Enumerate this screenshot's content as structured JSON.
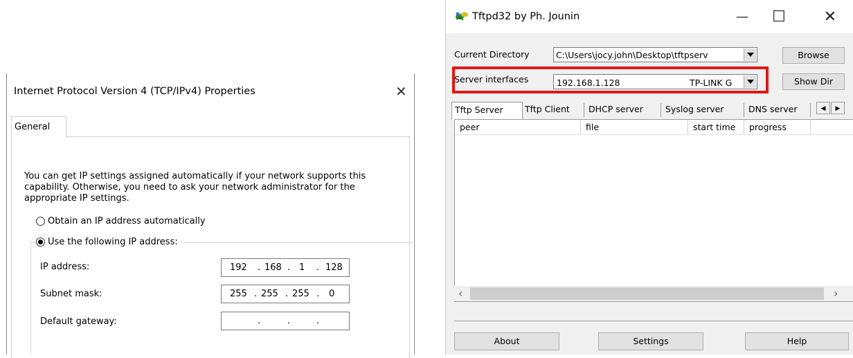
{
  "ipv4_dialog": {
    "title": "Internet Protocol Version 4 (TCP/IPv4) Properties",
    "close_glyph": "✕",
    "tab_general": "General",
    "description": "You can get IP settings assigned automatically if your network supports this capability. Otherwise, you need to ask your network administrator for the appropriate IP settings.",
    "radio_auto": "Obtain an IP address automatically",
    "radio_manual": "Use the following IP address:",
    "selected_option": "manual",
    "ip_address_label": "IP address:",
    "ip_address": [
      "192",
      "168",
      "1",
      "128"
    ],
    "subnet_mask_label": "Subnet mask:",
    "subnet_mask": [
      "255",
      "255",
      "255",
      "0"
    ],
    "default_gateway_label": "Default gateway:",
    "default_gateway": [
      "",
      "",
      "",
      ""
    ],
    "ip_separator": "."
  },
  "tftpd32": {
    "title": "Tftpd32 by Ph. Jounin",
    "minimize_glyph": "—",
    "maximize_glyph": "☐",
    "close_glyph": "✕",
    "current_directory_label": "Current Directory",
    "current_directory_value": "C:\\Users\\jocy.john\\Desktop\\tftpserv",
    "browse_button": "Browse",
    "server_interfaces_label": "Server interfaces",
    "server_interface_ip": "192.168.1.128",
    "server_interface_name": "TP-LINK G",
    "show_dir_button": "Show Dir",
    "tabs": [
      "Tftp Server",
      "Tftp Client",
      "DHCP server",
      "Syslog server",
      "DNS server"
    ],
    "tab_scroll_left": "◀",
    "tab_scroll_right": "▶",
    "columns": [
      "peer",
      "file",
      "start time",
      "progress"
    ],
    "scroll_left_glyph": "‹",
    "scroll_right_glyph": "›",
    "about_button": "About",
    "settings_button": "Settings",
    "help_button": "Help"
  },
  "colors": {
    "highlight_box": "#e01818",
    "window_bg": "#f0f0f0"
  }
}
